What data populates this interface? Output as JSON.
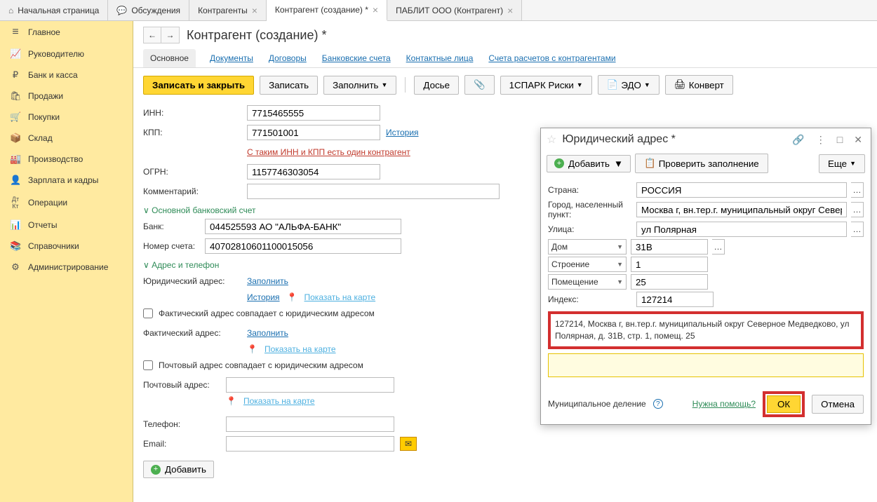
{
  "top_tabs": {
    "home": "Начальная страница",
    "discuss": "Обсуждения",
    "t1": "Контрагенты",
    "t2": "Контрагент (создание) *",
    "t3": "ПАБЛИТ ООО (Контрагент)"
  },
  "sidebar": {
    "items": [
      "Главное",
      "Руководителю",
      "Банк и касса",
      "Продажи",
      "Покупки",
      "Склад",
      "Производство",
      "Зарплата и кадры",
      "Операции",
      "Отчеты",
      "Справочники",
      "Администрирование"
    ]
  },
  "page": {
    "title": "Контрагент (создание) *"
  },
  "ftabs": [
    "Основное",
    "Документы",
    "Договоры",
    "Банковские счета",
    "Контактные лица",
    "Счета расчетов с контрагентами"
  ],
  "toolbar": {
    "save_close": "Записать и закрыть",
    "save": "Записать",
    "fill": "Заполнить",
    "dossier": "Досье",
    "spark": "1СПАРК Риски",
    "edo": "ЭДО",
    "convert": "Конверт"
  },
  "form": {
    "inn_label": "ИНН:",
    "inn_val": "7715465555",
    "kpp_label": "КПП:",
    "kpp_val": "771501001",
    "history": "История",
    "dup_warning": "С таким ИНН и КПП есть один контрагент",
    "ogrn_label": "ОГРН:",
    "ogrn_val": "1157746303054",
    "comment_label": "Комментарий:",
    "sec_bank": "Основной банковский счет",
    "bank_label": "Банк:",
    "bank_val": "044525593 АО \"АЛЬФА-БАНК\"",
    "acct_label": "Номер счета:",
    "acct_val": "40702810601100015056",
    "sec_addr": "Адрес и телефон",
    "legal_label": "Юридический адрес:",
    "fill_link": "Заполнить",
    "show_map": "Показать на карте",
    "fact_same": "Фактический адрес совпадает с юридическим адресом",
    "fact_label": "Фактический адрес:",
    "post_same": "Почтовый адрес совпадает с юридическим адресом",
    "post_label": "Почтовый адрес:",
    "phone_label": "Телефон:",
    "email_label": "Email:",
    "add": "Добавить"
  },
  "popup": {
    "title": "Юридический адрес *",
    "add": "Добавить",
    "check": "Проверить заполнение",
    "more": "Еще",
    "country_label": "Страна:",
    "country_val": "РОССИЯ",
    "city_label": "Город, населенный пункт:",
    "city_val": "Москва г, вн.тер.г. муниципальный округ Северное Медведково",
    "street_label": "Улица:",
    "street_val": "ул Полярная",
    "house_label": "Дом",
    "house_val": "31В",
    "bld_label": "Строение",
    "bld_val": "1",
    "room_label": "Помещение",
    "room_val": "25",
    "index_label": "Индекс:",
    "index_val": "127214",
    "full_addr": "127214, Москва г, вн.тер.г. муниципальный округ Северное Медведково, ул Полярная, д. 31В, стр. 1, помещ. 25",
    "munic": "Муниципальное деление",
    "help": "Нужна помощь?",
    "ok": "ОК",
    "cancel": "Отмена"
  }
}
